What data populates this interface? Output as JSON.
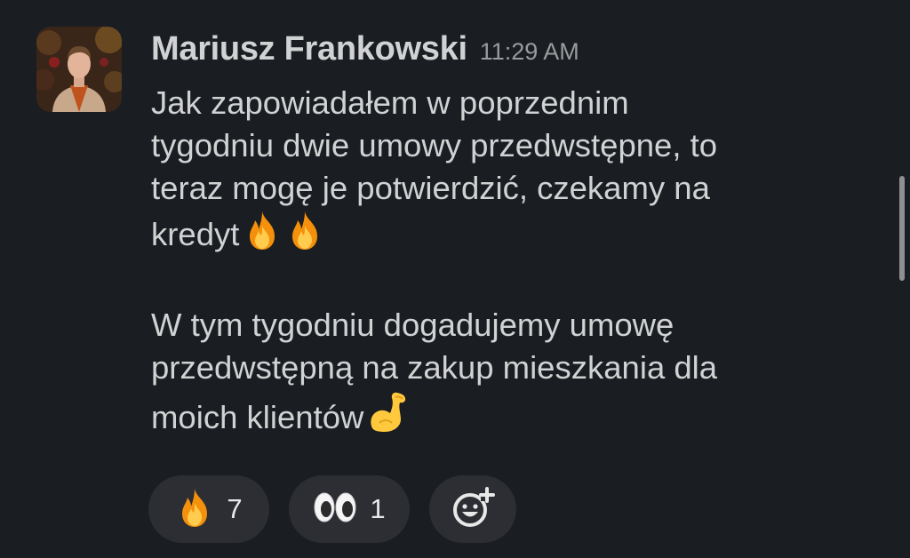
{
  "message": {
    "author": "Mariusz Frankowski",
    "timestamp": "11:29 AM",
    "paragraph1": [
      "Jak zapowiadałem w poprzednim",
      "tygodniu dwie umowy przedwstępne, to",
      "teraz mogę je potwierdzić, czekamy na",
      "kredyt"
    ],
    "paragraph2": [
      "W tym tygodniu dogadujemy umowę",
      "przedwstępną na zakup mieszkania dla",
      "moich klientów"
    ]
  },
  "icons": {
    "inline_1": "fire-emoji",
    "inline_2": "fire-emoji",
    "inline_3": "flexed-biceps-emoji"
  },
  "reactions": [
    {
      "icon": "fire-emoji",
      "count": "7"
    },
    {
      "icon": "eyes-emoji",
      "count": "1"
    },
    {
      "icon": "add-reaction-icon"
    }
  ],
  "colors": {
    "background": "#1a1d21",
    "text": "#d1d2d3",
    "timestamp": "#9a9b9d",
    "reaction_pill": "#2c2e33"
  }
}
